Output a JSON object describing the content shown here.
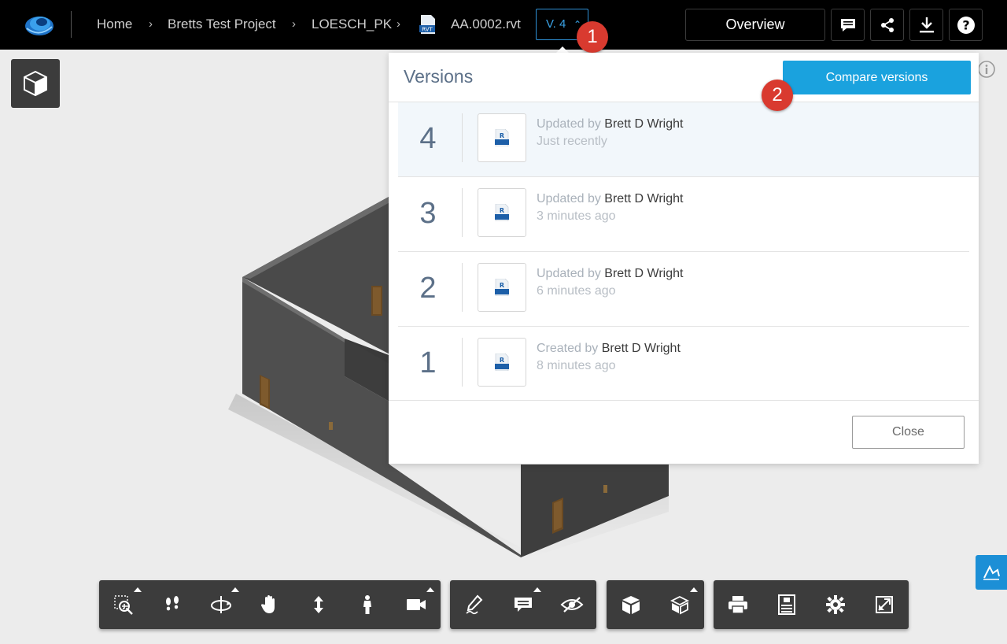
{
  "header": {
    "breadcrumbs": [
      "Home",
      "Bretts Test Project",
      "LOESCH_PK"
    ],
    "file_name": "AA.0002.rvt",
    "version_label": "V. 4",
    "overview_label": "Overview",
    "icons": [
      "app-logo-icon",
      "rvt-file-icon",
      "comment-icon",
      "share-icon",
      "download-icon",
      "help-icon"
    ]
  },
  "callouts": {
    "first": "1",
    "second": "2"
  },
  "versions_panel": {
    "title": "Versions",
    "compare_label": "Compare versions",
    "close_label": "Close",
    "versions": [
      {
        "number": "4",
        "action": "Updated by",
        "author": "Brett D Wright",
        "time": "Just recently"
      },
      {
        "number": "3",
        "action": "Updated by",
        "author": "Brett D Wright",
        "time": "3 minutes ago"
      },
      {
        "number": "2",
        "action": "Updated by",
        "author": "Brett D Wright",
        "time": "6 minutes ago"
      },
      {
        "number": "1",
        "action": "Created by",
        "author": "Brett D Wright",
        "time": "8 minutes ago"
      }
    ]
  },
  "colors": {
    "accent": "#1aa2de",
    "callout": "#d93a2f",
    "toolbar": "#3c3c3c",
    "topbar": "#000000"
  },
  "toolbar_icons": [
    "zoom-window-icon",
    "footsteps-icon",
    "orbit-icon",
    "pan-hand-icon",
    "zoom-vertical-icon",
    "first-person-icon",
    "camera-icon",
    "markup-pencil-icon",
    "comment-icon",
    "hide-icon",
    "model-browser-icon",
    "explode-model-icon",
    "print-icon",
    "properties-icon",
    "settings-icon",
    "fullscreen-icon"
  ]
}
